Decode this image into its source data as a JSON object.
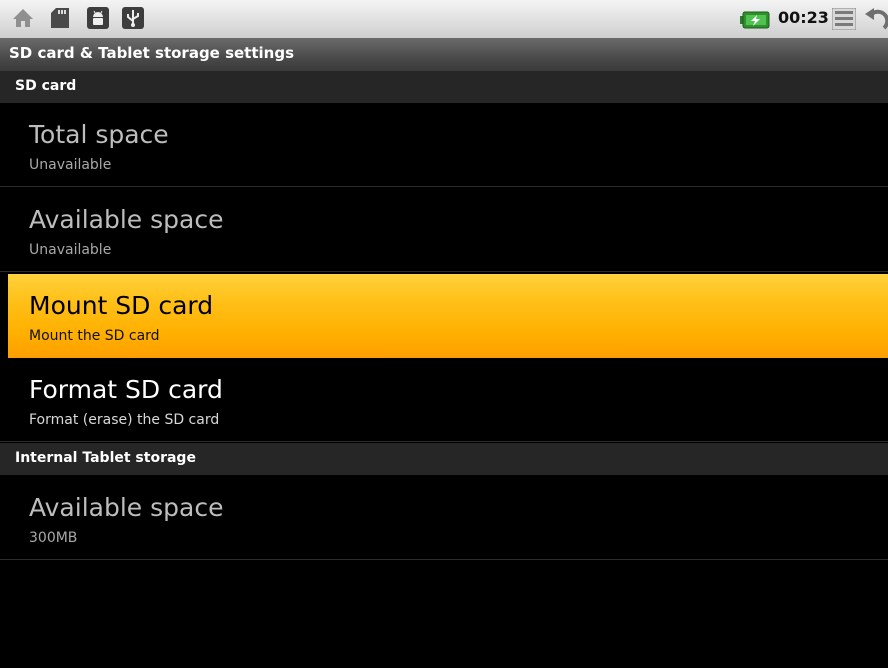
{
  "status_bar": {
    "icons": [
      "home-icon",
      "sd-card-icon",
      "android-debug-icon",
      "usb-icon",
      "battery-charging-icon",
      "menu-icon",
      "back-icon"
    ],
    "time": "00:23"
  },
  "screen": {
    "title": "SD card & Tablet storage settings"
  },
  "sections": {
    "sd_card": {
      "header": "SD card",
      "items": [
        {
          "title": "Total space",
          "summary": "Unavailable"
        },
        {
          "title": "Available space",
          "summary": "Unavailable"
        },
        {
          "title": "Mount SD card",
          "summary": "Mount the SD card"
        },
        {
          "title": "Format SD card",
          "summary": "Format (erase) the SD card"
        }
      ]
    },
    "internal": {
      "header": "Internal Tablet storage",
      "items": [
        {
          "title": "Available space",
          "summary": "300MB"
        }
      ]
    }
  },
  "colors": {
    "highlight": "#ffb000",
    "background": "#000000",
    "battery_accent": "#3aa83a"
  }
}
